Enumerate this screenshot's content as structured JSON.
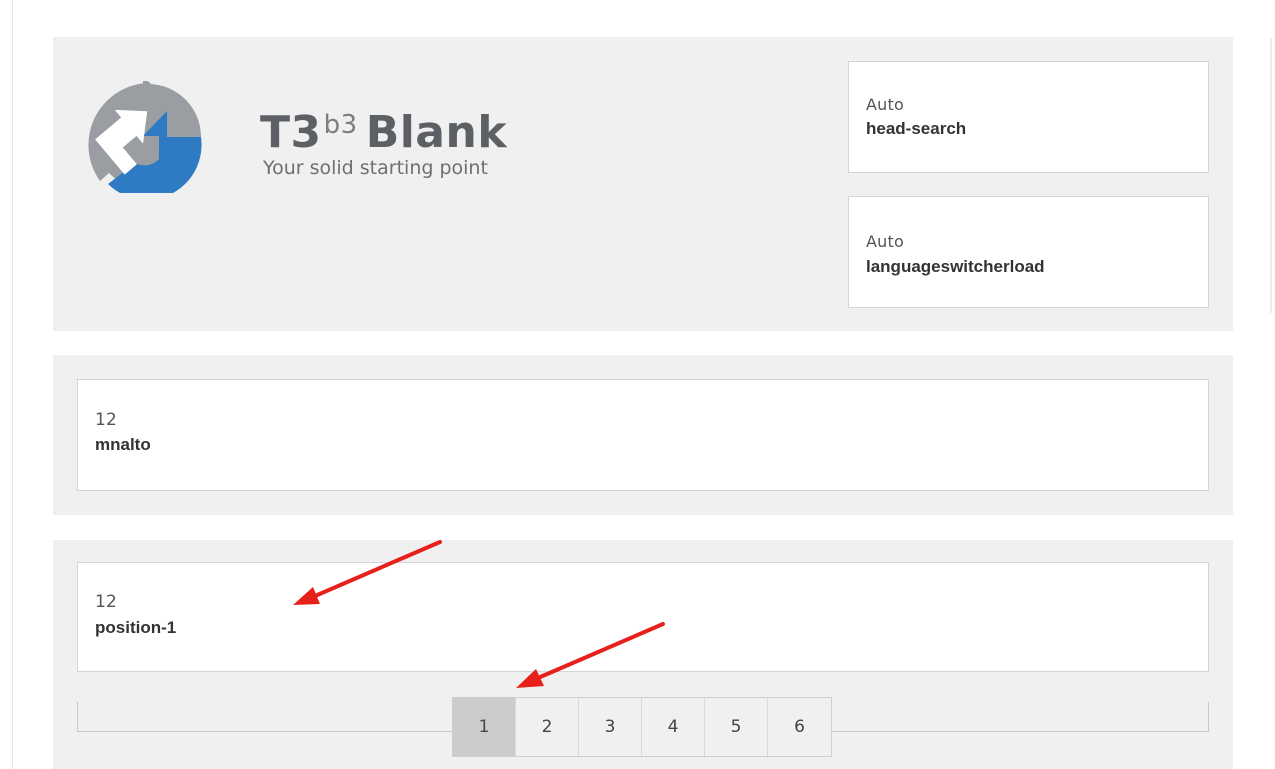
{
  "colors": {
    "section_background": "#f0f0f0",
    "module_background": "#ffffff",
    "annotation_arrow": "#e8201c",
    "logo_gray": "#9a9ea2",
    "logo_blue": "#2f7bc3",
    "active_page": "#cccccc"
  },
  "header": {
    "logo": {
      "title_main": "T3",
      "title_sup": "b3",
      "title_word": "Blank",
      "tagline": "Your solid starting point",
      "icon": "t3-logo-icon"
    },
    "modules": [
      {
        "meta": "Auto",
        "name": "head-search"
      },
      {
        "meta": "Auto",
        "name": "languageswitcherload"
      }
    ]
  },
  "mnalto": {
    "meta": "12",
    "name": "mnalto"
  },
  "position": {
    "meta": "12",
    "name": "position-1",
    "pages": [
      "1",
      "2",
      "3",
      "4",
      "5",
      "6"
    ],
    "active_page": "1"
  },
  "annotations": [
    {
      "icon": "red-arrow-icon",
      "points_to": "position-1 module"
    },
    {
      "icon": "red-arrow-icon",
      "points_to": "page 1 button"
    }
  ]
}
